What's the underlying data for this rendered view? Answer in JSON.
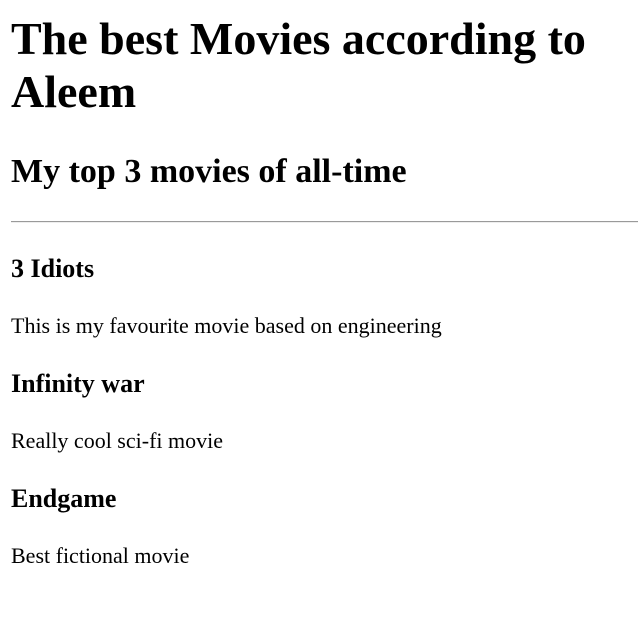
{
  "page": {
    "title": "The best Movies according to Aleem",
    "subtitle": "My top 3 movies of all-time"
  },
  "movies": [
    {
      "title": "3 Idiots",
      "description": "This is my favourite movie based on engineering"
    },
    {
      "title": "Infinity war",
      "description": "Really cool sci-fi movie"
    },
    {
      "title": "Endgame",
      "description": "Best fictional movie"
    }
  ]
}
